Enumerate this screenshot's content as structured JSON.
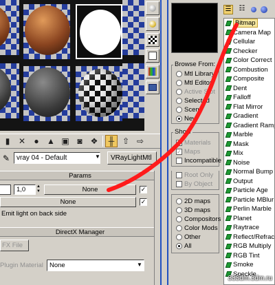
{
  "material_editor": {
    "side_buttons": [
      "sample-type-icon",
      "backlight-icon",
      "background-icon",
      "uv-tiling-icon",
      "video-color-check-icon",
      "make-preview-icon"
    ],
    "toolbar": {
      "buttons": [
        "get-material-icon",
        "put-to-scene-icon",
        "assign-to-selection-icon",
        "reset-map-icon",
        "copy-material-icon",
        "make-unique-icon",
        "put-to-library-icon",
        "material-id-icon",
        "show-in-viewport-icon",
        "show-end-result-icon",
        "go-to-parent-icon",
        "go-forward-to-sibling-icon"
      ],
      "active_button": "show-end-result-icon"
    },
    "material_name": "vray 04 - Default",
    "material_type": "VRayLightMtl",
    "params": {
      "rollout_title": "Params",
      "multiplier": "1,0",
      "map_button_1": "None",
      "map_button_2": "None",
      "emit_back_label": "Emit light on back side"
    },
    "directx": {
      "rollout_title": "DirectX Manager",
      "fx_file_label": "FX File",
      "plugin_label": "Plugin Material",
      "plugin_value": "None"
    }
  },
  "browser": {
    "browse_from": {
      "title": "Browse From:",
      "options": [
        "Mtl Library",
        "Mtl Editor",
        "Active Slot",
        "Selected",
        "Scene",
        "New"
      ],
      "selected": "New",
      "disabled": [
        "Active Slot"
      ]
    },
    "show": {
      "title": "Show",
      "options": [
        {
          "label": "Materials",
          "checked": false,
          "disabled": true
        },
        {
          "label": "Maps",
          "checked": true,
          "disabled": true
        },
        {
          "label": "Incompatible",
          "checked": false,
          "disabled": false
        }
      ]
    },
    "root": {
      "options": [
        {
          "label": "Root Only",
          "disabled": true
        },
        {
          "label": "By Object",
          "disabled": true
        }
      ]
    },
    "map_filter": {
      "options": [
        "2D maps",
        "3D maps",
        "Compositors",
        "Color Mods",
        "Other",
        "All"
      ],
      "selected": "All"
    },
    "list_toolbar": [
      "view-list-text-icon",
      "view-list-icons-icon",
      "view-small-icons-icon",
      "view-large-icons-icon"
    ],
    "map_list": [
      "Bitmap",
      "Camera Map",
      "Cellular",
      "Checker",
      "Color Correct",
      "Combustion",
      "Composite",
      "Dent",
      "Falloff",
      "Flat Mirror",
      "Gradient",
      "Gradient Ramp",
      "Marble",
      "Mask",
      "Mix",
      "Noise",
      "Normal Bump",
      "Output",
      "Particle Age",
      "Particle MBlur",
      "Perlin Marble",
      "Planet",
      "Raytrace",
      "Reflect/Refract",
      "RGB Multiply",
      "RGB Tint",
      "Smoke",
      "Speckle"
    ],
    "selected_map": "Bitmap"
  },
  "watermark": "333dm.3dm.ru",
  "colors": {
    "panel": "#d4d0c8",
    "selection": "#f5e79e",
    "map_icon": "#1f9a34",
    "annotation": "#ff1b1b",
    "divider": "#2050c0"
  }
}
